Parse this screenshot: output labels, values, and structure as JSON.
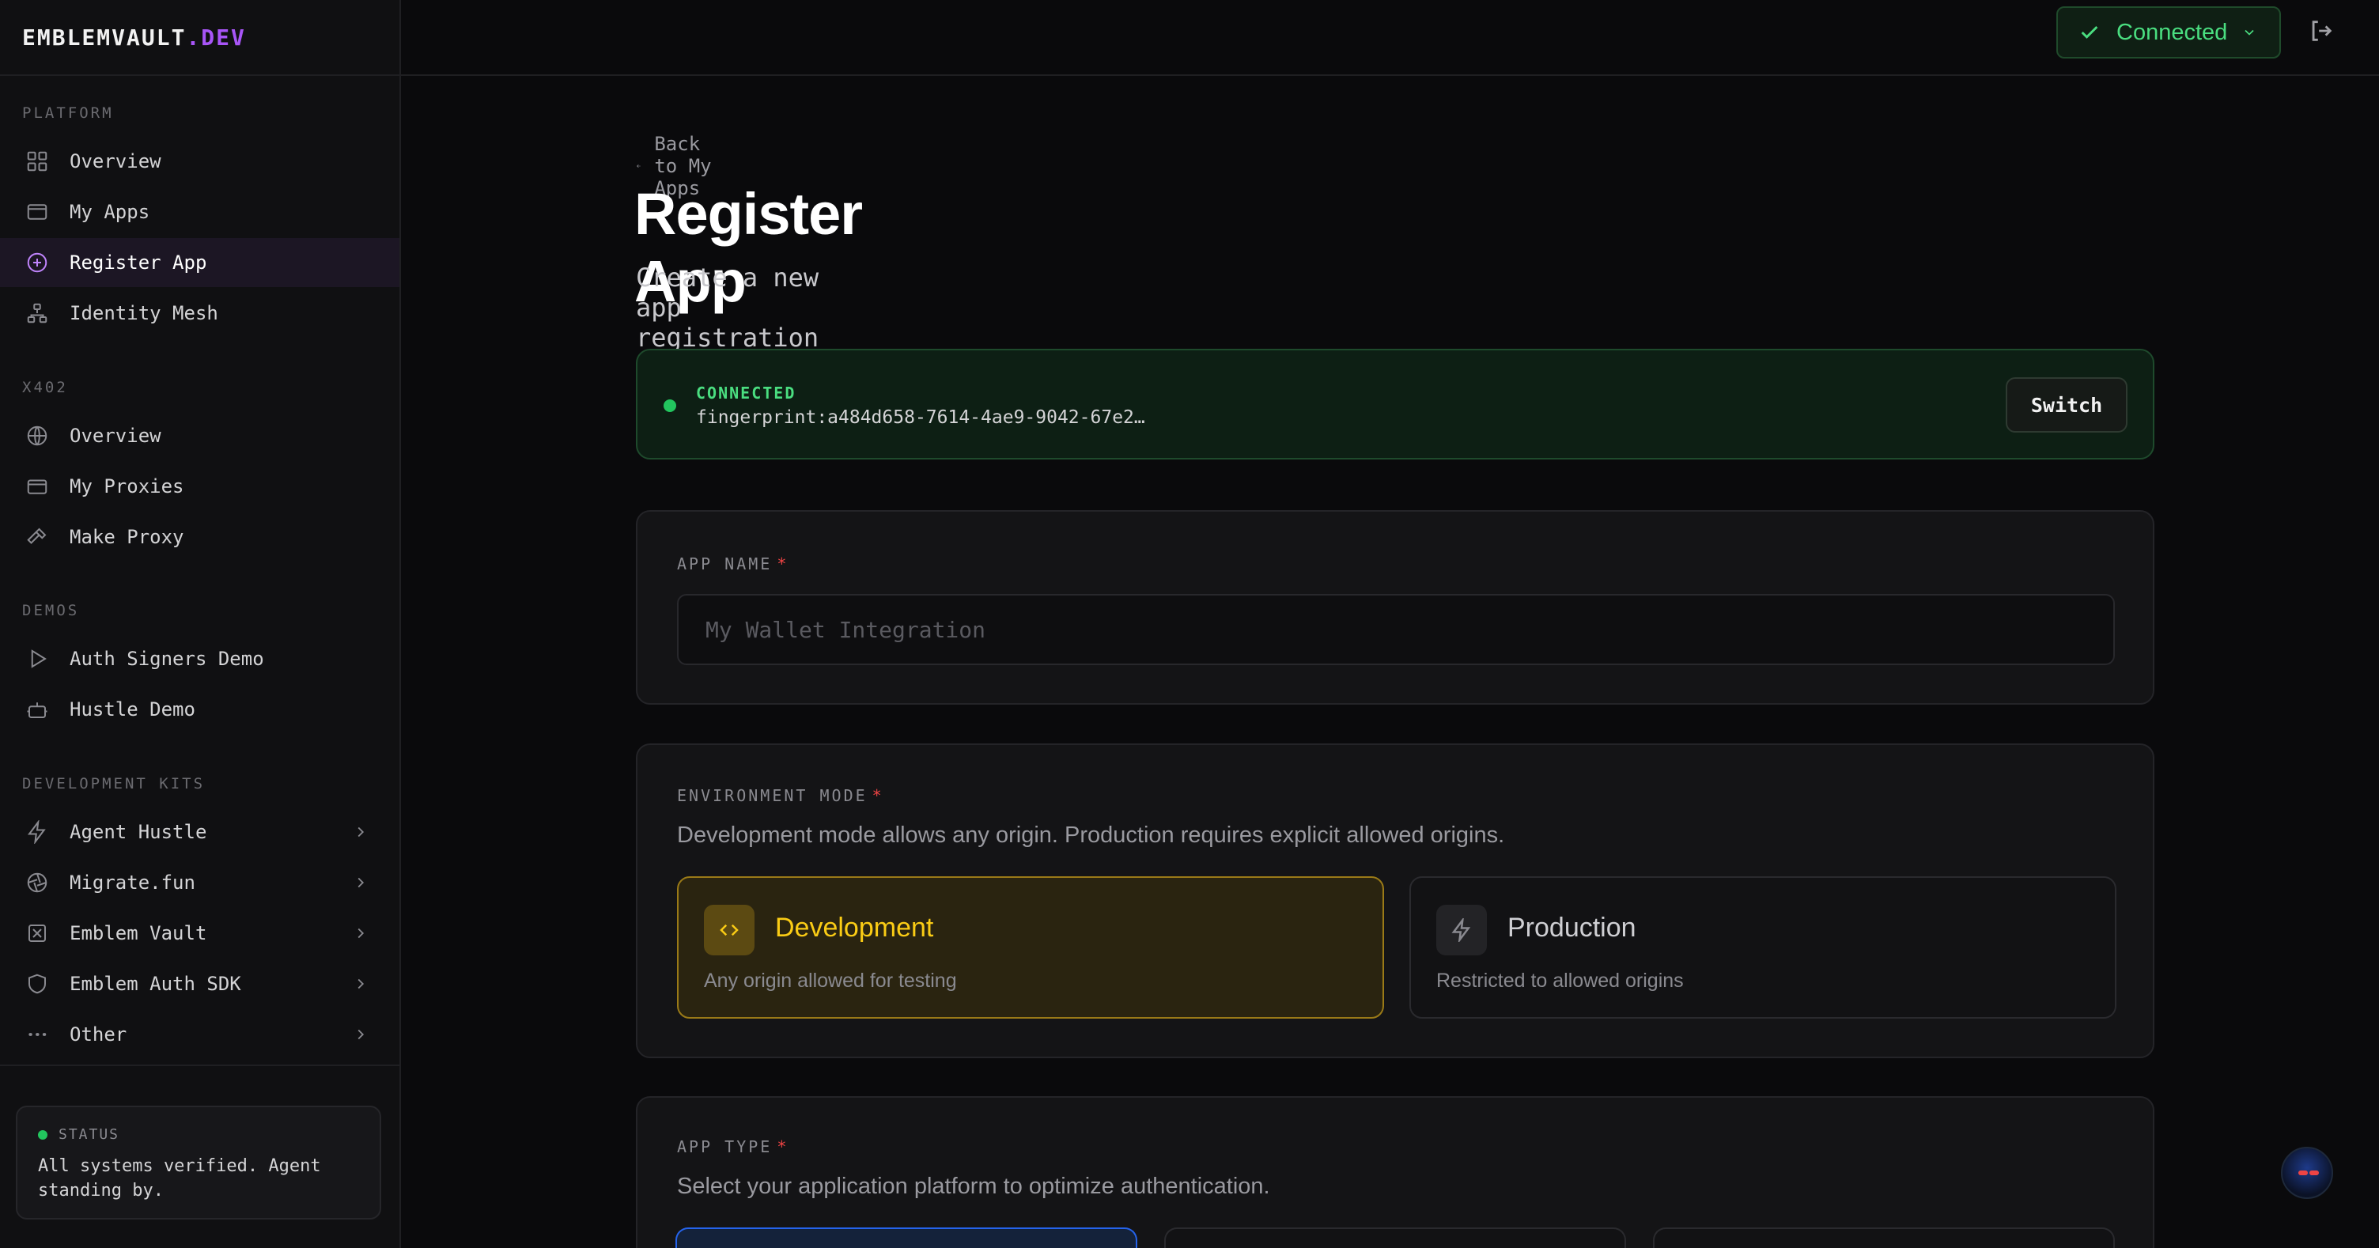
{
  "brand": {
    "name": "EMBLEMVAULT",
    "suffix": ".DEV"
  },
  "sidebar": {
    "sections": [
      {
        "title": "PLATFORM",
        "items": [
          {
            "label": "Overview",
            "icon": "grid-icon"
          },
          {
            "label": "My Apps",
            "icon": "browser-window-icon"
          },
          {
            "label": "Register App",
            "icon": "plus-circle-icon",
            "active": true
          },
          {
            "label": "Identity Mesh",
            "icon": "network-icon"
          }
        ]
      },
      {
        "title": "X402",
        "items": [
          {
            "label": "Overview",
            "icon": "globe-icon"
          },
          {
            "label": "My Proxies",
            "icon": "card-icon"
          },
          {
            "label": "Make Proxy",
            "icon": "hammer-icon"
          }
        ]
      },
      {
        "title": "DEMOS",
        "items": [
          {
            "label": "Auth Signers Demo",
            "icon": "play-icon"
          },
          {
            "label": "Hustle Demo",
            "icon": "bot-icon"
          }
        ]
      },
      {
        "title": "DEVELOPMENT KITS",
        "items": [
          {
            "label": "Agent Hustle",
            "icon": "bolt-icon"
          },
          {
            "label": "Migrate.fun",
            "icon": "aperture-icon"
          },
          {
            "label": "Emblem Vault",
            "icon": "vault-icon"
          },
          {
            "label": "Emblem Auth SDK",
            "icon": "shield-icon"
          },
          {
            "label": "Other",
            "icon": "more-icon"
          }
        ]
      }
    ]
  },
  "status": {
    "title": "STATUS",
    "text": "All systems verified. Agent standing by.",
    "color": "#22c55e"
  },
  "topbar": {
    "connected_label": "Connected"
  },
  "main": {
    "back_label": "Back to My Apps",
    "title": "Register App",
    "subtitle": "Create a new app registration to enable wallet connections.",
    "connection": {
      "label": "CONNECTED",
      "fingerprint": "fingerprint:a484d658-7614-4ae9-9042-67e2…",
      "switch_label": "Switch"
    },
    "app_name": {
      "label": "APP NAME",
      "required": "*",
      "placeholder": "My Wallet Integration",
      "value": ""
    },
    "environment": {
      "label": "ENVIRONMENT MODE",
      "required": "*",
      "help": "Development mode allows any origin. Production requires explicit allowed origins.",
      "options": [
        {
          "title": "Development",
          "desc": "Any origin allowed for testing",
          "selected": true,
          "icon": "code-icon"
        },
        {
          "title": "Production",
          "desc": "Restricted to allowed origins",
          "selected": false,
          "icon": "bolt-icon"
        }
      ]
    },
    "app_type": {
      "label": "APP TYPE",
      "required": "*",
      "help": "Select your application platform to optimize authentication."
    }
  },
  "colors": {
    "accent": "#a855f7",
    "success": "#22c55e",
    "dev": "#facc15",
    "selected_type": "#2563eb"
  }
}
